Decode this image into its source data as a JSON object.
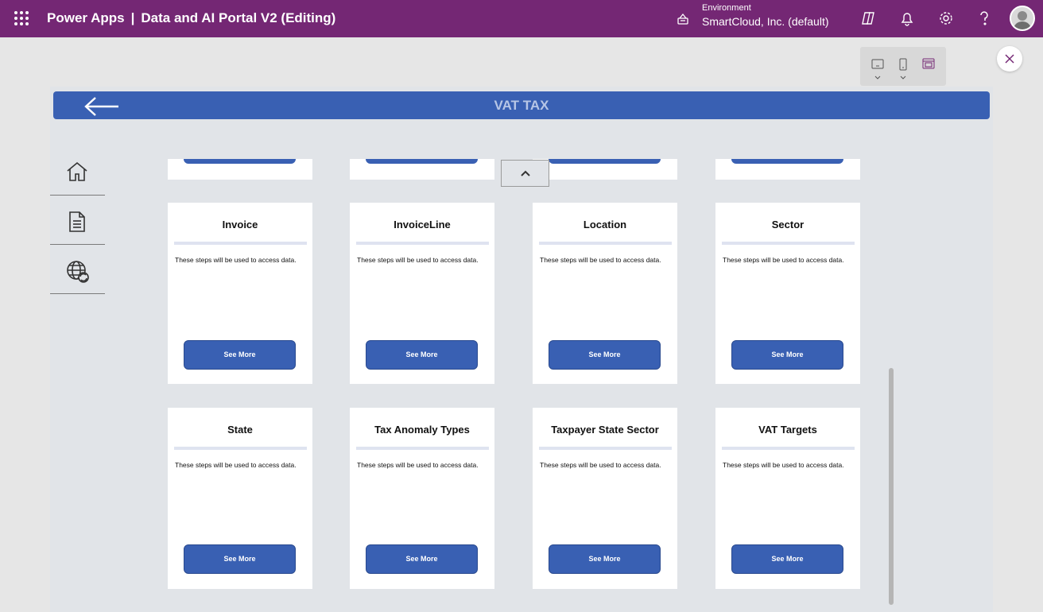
{
  "topbar": {
    "app_name": "Power Apps",
    "separator": "|",
    "document_title": "Data and AI Portal V2 (Editing)",
    "environment_label": "Environment",
    "environment_value": "SmartCloud, Inc. (default)",
    "icons": [
      "app-launcher-icon",
      "environment-icon",
      "copilot-icon",
      "bell-icon",
      "gear-icon",
      "help-icon",
      "avatar"
    ],
    "accent_color": "#742774"
  },
  "device_toolbar": {
    "icons": [
      "tablet-icon",
      "phone-icon",
      "web-layout-icon"
    ]
  },
  "screen": {
    "title": "VAT TAX",
    "header_color": "#3960b3",
    "nav": [
      "home-icon",
      "document-icon",
      "globe-refresh-icon"
    ]
  },
  "cards": [
    {
      "title": "Invoice",
      "description": "These steps will be used to access data.",
      "button": "See More"
    },
    {
      "title": "InvoiceLine",
      "description": "These steps will be used to access data.",
      "button": "See More"
    },
    {
      "title": "Location",
      "description": "These steps will be used to access data.",
      "button": "See More"
    },
    {
      "title": "Sector",
      "description": "These steps will be used to access data.",
      "button": "See More"
    },
    {
      "title": "State",
      "description": "These steps will be used to access data.",
      "button": "See More"
    },
    {
      "title": "Tax Anomaly Types",
      "description": "These steps will be used to access data.",
      "button": "See More"
    },
    {
      "title": "Taxpayer State Sector",
      "description": "These steps will be used to access data.",
      "button": "See More"
    },
    {
      "title": "VAT Targets",
      "description": "These steps will be used to access data.",
      "button": "See More"
    }
  ]
}
